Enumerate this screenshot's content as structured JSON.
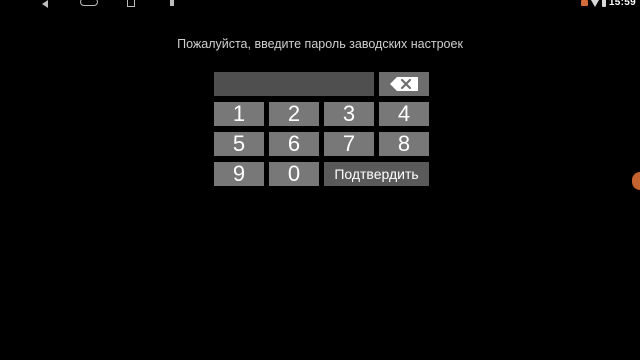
{
  "status_bar": {
    "time": "15:59",
    "icons": {
      "back": "back-icon",
      "home": "home-icon",
      "recents": "recents-icon",
      "notification": "notification-icon",
      "cast": "cast-icon",
      "wifi": "wifi-icon",
      "battery": "battery-icon"
    }
  },
  "prompt": "Пожалуйста, введите пароль заводских настроек",
  "pin_input": {
    "value": ""
  },
  "keypad": {
    "keys": [
      "1",
      "2",
      "3",
      "4",
      "5",
      "6",
      "7",
      "8",
      "9",
      "0"
    ],
    "backspace_icon": "backspace-icon",
    "confirm_label": "Подтвердить"
  },
  "colors": {
    "background": "#000000",
    "key": "#787878",
    "field": "#4f4f4f",
    "confirm": "#5a5a5a",
    "accent": "#c4632f"
  }
}
